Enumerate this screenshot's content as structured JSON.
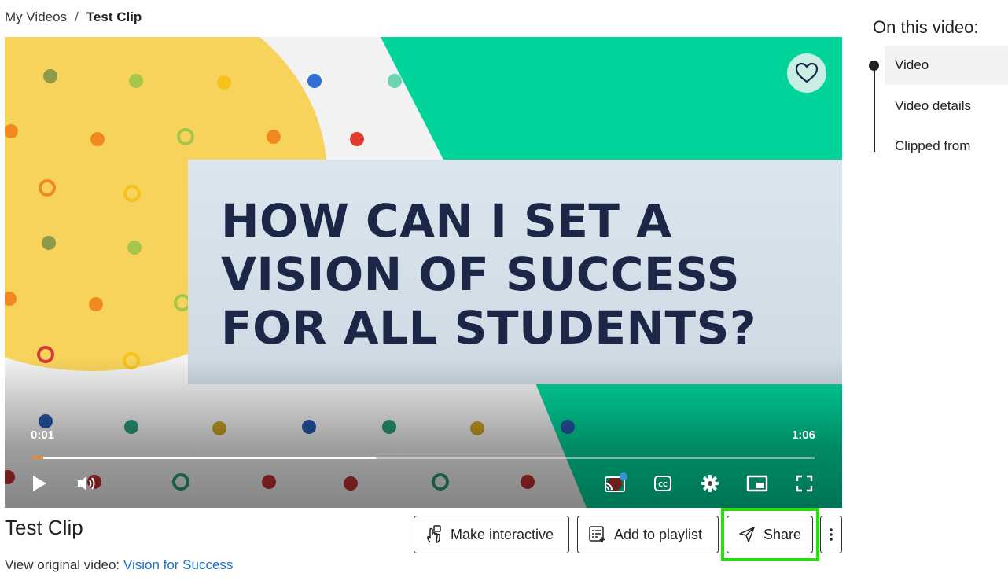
{
  "breadcrumb": {
    "parent": "My Videos",
    "separator": "/",
    "current": "Test Clip"
  },
  "player": {
    "headline": "HOW CAN I SET A\nVISION OF SUCCESS\nFOR ALL STUDENTS?",
    "current_time": "0:01",
    "duration": "1:06",
    "played_fraction": 0.015,
    "buffered_fraction": 0.44,
    "controls": [
      "play-icon",
      "volume-icon",
      "cast-icon",
      "captions-icon",
      "settings-icon",
      "picture-in-picture-icon",
      "fullscreen-icon"
    ],
    "favorite_icon": "heart-icon"
  },
  "video": {
    "title": "Test Clip",
    "original_label": "View original video:",
    "original_link": "Vision for Success"
  },
  "actions": {
    "make_interactive": "Make interactive",
    "add_to_playlist": "Add to playlist",
    "share": "Share",
    "more_icon": "kebab-icon"
  },
  "toc": {
    "heading": "On this video:",
    "items": [
      {
        "label": "Video",
        "active": true
      },
      {
        "label": "Video details"
      },
      {
        "label": "Clipped from"
      }
    ]
  },
  "colors": {
    "accent_green": "#00d49a",
    "highlight": "#2bdc12",
    "link": "#1b72c4",
    "progress": "#f08a24"
  }
}
